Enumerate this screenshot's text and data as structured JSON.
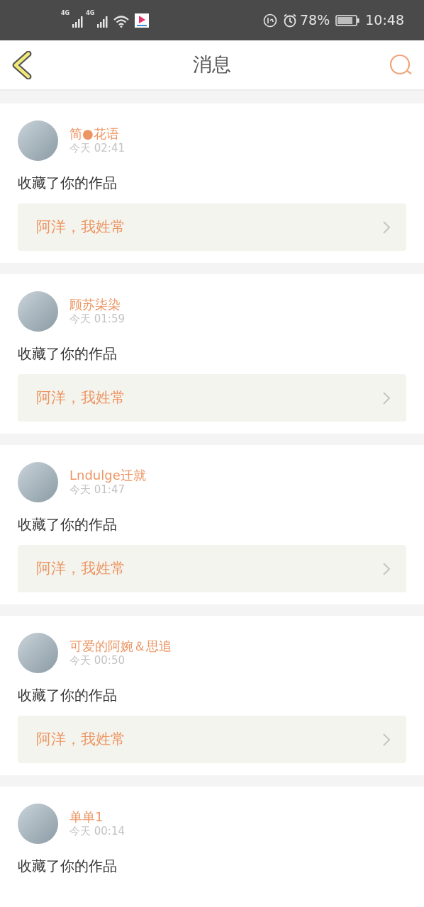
{
  "status_bar": {
    "network_labels": [
      "4G",
      "4G"
    ],
    "battery": "78%",
    "time": "10:48"
  },
  "header": {
    "title": "消息"
  },
  "messages": [
    {
      "user": "简●花语",
      "time": "今天 02:41",
      "action": "收藏了你的作品",
      "work": "阿洋，我姓常"
    },
    {
      "user": "顾苏柒染",
      "time": "今天 01:59",
      "action": "收藏了你的作品",
      "work": "阿洋，我姓常"
    },
    {
      "user": "Lndulge迁就",
      "time": "今天 01:47",
      "action": "收藏了你的作品",
      "work": "阿洋，我姓常"
    },
    {
      "user": "可爱的阿婉＆思追",
      "time": "今天 00:50",
      "action": "收藏了你的作品",
      "work": "阿洋，我姓常"
    },
    {
      "user": "单单1",
      "time": "今天 00:14",
      "action": "收藏了你的作品"
    }
  ]
}
